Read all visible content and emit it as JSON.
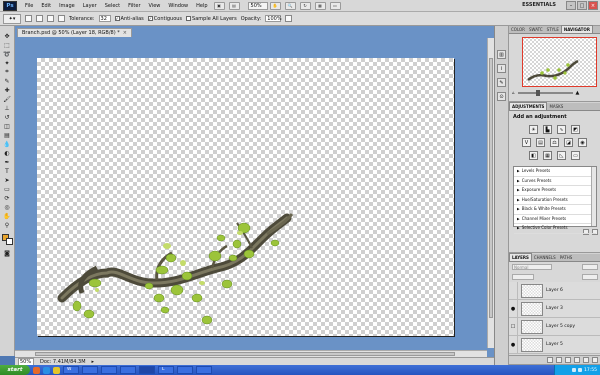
{
  "app": {
    "logo": "Ps",
    "menu": [
      "File",
      "Edit",
      "Image",
      "Layer",
      "Select",
      "Filter",
      "View",
      "Window",
      "Help"
    ],
    "zoom_value": "50%",
    "workspace": "ESSENTIALS"
  },
  "options_bar": {
    "tolerance_label": "Tolerance:",
    "tolerance_value": "32",
    "anti_alias_label": "Anti-alias",
    "contiguous_label": "Contiguous",
    "sample_all_label": "Sample All Layers",
    "opacity_label": "Opacity:",
    "opacity_value": "100%"
  },
  "document": {
    "tab_title": "Branch.psd @ 50% (Layer 18, RGB/8) *",
    "close": "×"
  },
  "status": {
    "zoom": "50%",
    "doc_info": "Doc: 7.41M/84.3M"
  },
  "panels": {
    "top_tabs": [
      "COLOR",
      "SWATC",
      "STYLE",
      "NAVIGATOR"
    ],
    "adjustments_tabs": [
      "ADJUSTMENTS",
      "MASKS"
    ],
    "adjustments_title": "Add an adjustment",
    "presets": [
      "Levels Presets",
      "Curves Presets",
      "Exposure Presets",
      "Hue/Saturation Presets",
      "Black & White Presets",
      "Channel Mixer Presets",
      "Selective Color Presets"
    ],
    "layers_tabs": [
      "LAYERS",
      "CHANNELS",
      "PATHS"
    ],
    "blend_mode": "Normal",
    "layers": [
      {
        "name": "Layer 6",
        "visible": false
      },
      {
        "name": "Layer 3",
        "visible": true
      },
      {
        "name": "Layer 5 copy",
        "visible": false
      },
      {
        "name": "Layer 5",
        "visible": true
      }
    ]
  },
  "taskbar": {
    "start": "start",
    "buttons": [
      "W",
      "",
      "",
      "",
      "",
      "L",
      "",
      ""
    ],
    "clock": "17:55"
  },
  "colors": {
    "foreground": "#e7a32b",
    "background": "#ffffff",
    "canvas_bg": "#6a92c6"
  }
}
